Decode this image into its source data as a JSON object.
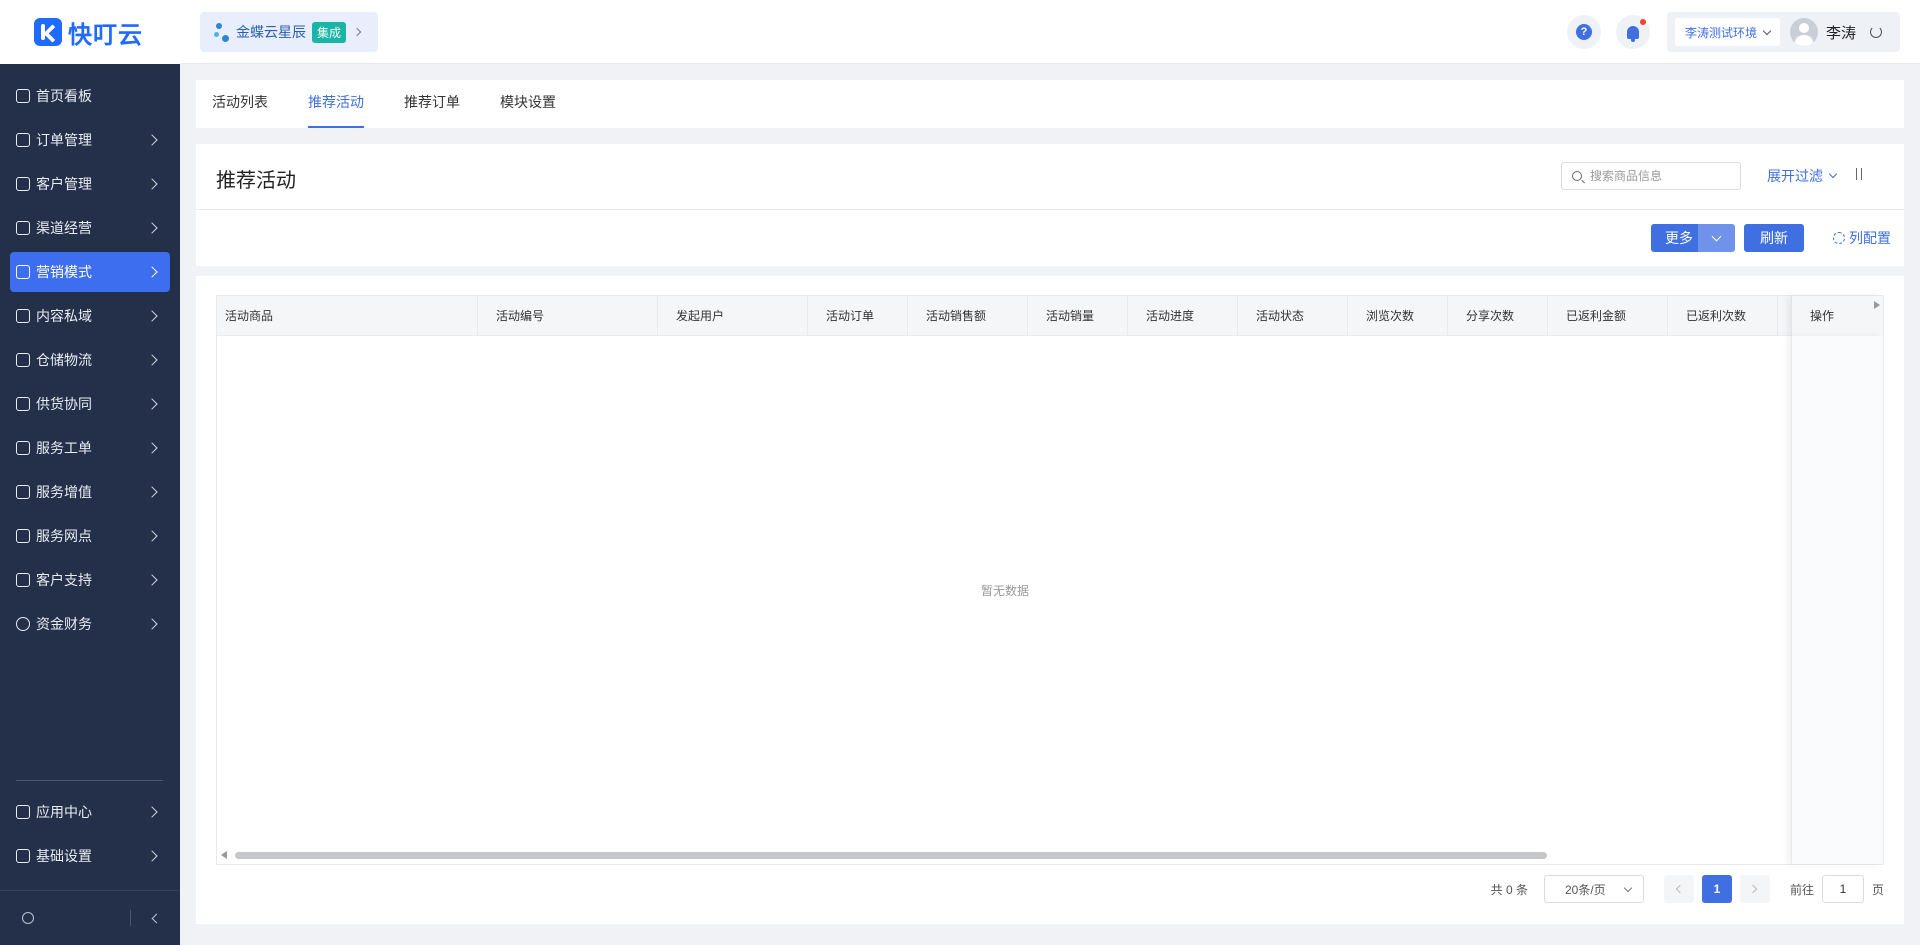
{
  "app": {
    "name": "快叮云"
  },
  "tenant": {
    "name": "金蝶云星辰",
    "badge": "集成"
  },
  "header": {
    "env": "李涛测试环境",
    "username": "李涛"
  },
  "sidebar": {
    "items": [
      {
        "label": "首页看板"
      },
      {
        "label": "订单管理"
      },
      {
        "label": "客户管理"
      },
      {
        "label": "渠道经营"
      },
      {
        "label": "营销模式"
      },
      {
        "label": "内容私域"
      },
      {
        "label": "仓储物流"
      },
      {
        "label": "供货协同"
      },
      {
        "label": "服务工单"
      },
      {
        "label": "服务增值"
      },
      {
        "label": "服务网点"
      },
      {
        "label": "客户支持"
      },
      {
        "label": "资金财务"
      }
    ],
    "bottom_items": [
      {
        "label": "应用中心"
      },
      {
        "label": "基础设置"
      }
    ]
  },
  "tabs": [
    {
      "label": "活动列表"
    },
    {
      "label": "推荐活动"
    },
    {
      "label": "推荐订单"
    },
    {
      "label": "模块设置"
    }
  ],
  "page": {
    "title": "推荐活动",
    "search_placeholder": "搜索商品信息",
    "filter_toggle": "展开过滤"
  },
  "toolbar": {
    "more": "更多",
    "refresh": "刷新",
    "column_config": "列配置"
  },
  "table": {
    "columns": [
      "活动商品",
      "活动编号",
      "发起用户",
      "活动订单",
      "活动销售额",
      "活动销量",
      "活动进度",
      "活动状态",
      "浏览次数",
      "分享次数",
      "已返利金额",
      "已返利次数"
    ],
    "action_column": "操作",
    "empty_text": "暂无数据"
  },
  "pagination": {
    "total_text": "共 0 条",
    "page_size": "20条/页",
    "current_page": "1",
    "goto_label": "前往",
    "goto_value": "1",
    "page_suffix": "页"
  }
}
